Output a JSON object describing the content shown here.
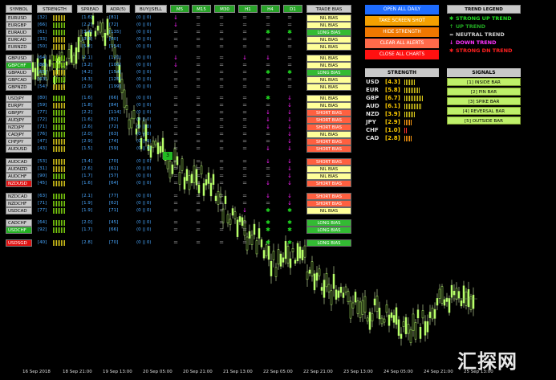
{
  "headers": {
    "symbol": "SYMBOL",
    "strength": "STRENGTH",
    "spread": "SPREAD",
    "adr": "ADR(5)",
    "buysell": "BUY||SELL",
    "m5": "M5",
    "m15": "M15",
    "m30": "M30",
    "h1": "H1",
    "h4": "H4",
    "d1": "D1",
    "trade_bias": "TRADE BIAS"
  },
  "rows": [
    {
      "symbol": "EURUSD",
      "sym_color": "grey",
      "strength": "[32]",
      "spread": "[1.6]",
      "adr": "[81]",
      "bs": "(0 || 0)",
      "tf": [
        "dn",
        "nt",
        "nt",
        "nt",
        "nt",
        "nt"
      ],
      "bias": "NIL BIAS",
      "bias_type": "nil"
    },
    {
      "symbol": "EURGBP",
      "sym_color": "grey",
      "strength": "[66]",
      "spread": "[2.2]",
      "adr": "[72]",
      "bs": "(0 || 0)",
      "tf": [
        "dn",
        "nt",
        "nt",
        "nt",
        "nt",
        "nt"
      ],
      "bias": "NIL BIAS",
      "bias_type": "nil"
    },
    {
      "symbol": "EURAUD",
      "sym_color": "grey",
      "strength": "[61]",
      "spread": "[3.4]",
      "adr": "[135]",
      "bs": "(0 || 0)",
      "tf": [
        "nt",
        "nt",
        "nt",
        "nt",
        "up",
        "up"
      ],
      "bias": "LONG BIAS",
      "bias_type": "long"
    },
    {
      "symbol": "EURCAD",
      "sym_color": "grey",
      "strength": "[33]",
      "spread": "[3.3]",
      "adr": "[80]",
      "bs": "(0 || 0)",
      "tf": [
        "nt",
        "nt",
        "nt",
        "nt",
        "nt",
        "nt"
      ],
      "bias": "NIL BIAS",
      "bias_type": "nil"
    },
    {
      "symbol": "EURNZD",
      "sym_color": "grey",
      "strength": "[50]",
      "spread": "[5.2]",
      "adr": "[154]",
      "bs": "(0 || 0)",
      "tf": [
        "nt",
        "nt",
        "nt",
        "nt",
        "nt",
        "nt"
      ],
      "bias": "NIL BIAS",
      "bias_type": "nil"
    },
    {
      "symbol": "GBPUSD",
      "sym_color": "grey",
      "strength": "[64]",
      "spread": "[2.1]",
      "adr": "[120]",
      "bs": "(0 || 0)",
      "tf": [
        "dn",
        "nt",
        "nt",
        "dn",
        "dn",
        "nt"
      ],
      "bias": "NIL BIAS",
      "bias_type": "nil"
    },
    {
      "symbol": "GBPCHF",
      "sym_color": "green",
      "strength": "[86]",
      "spread": "[3.2]",
      "adr": "[106]",
      "bs": "(0 || 0)",
      "tf": [
        "dn",
        "nt",
        "nt",
        "nt",
        "nt",
        "nt"
      ],
      "bias": "NIL BIAS",
      "bias_type": "nil"
    },
    {
      "symbol": "GBPAUD",
      "sym_color": "grey",
      "strength": "[55]",
      "spread": "[4.2]",
      "adr": "[154]",
      "bs": "(0 || 0)",
      "tf": [
        "nt",
        "nt",
        "nt",
        "nt",
        "up",
        "up"
      ],
      "bias": "LONG BIAS",
      "bias_type": "long"
    },
    {
      "symbol": "GBPCAD",
      "sym_color": "grey",
      "strength": "[63]",
      "spread": "[4.3]",
      "adr": "[125]",
      "bs": "(0 || 0)",
      "tf": [
        "nt",
        "nt",
        "nt",
        "nt",
        "nt",
        "nt"
      ],
      "bias": "NIL BIAS",
      "bias_type": "nil"
    },
    {
      "symbol": "GBPNZD",
      "sym_color": "grey",
      "strength": "[54]",
      "spread": "[2.9]",
      "adr": "[199]",
      "bs": "(0 || 0)",
      "tf": [
        "nt",
        "nt",
        "nt",
        "nt",
        "nt",
        "nt"
      ],
      "bias": "NIL BIAS",
      "bias_type": "nil"
    },
    {
      "symbol": "USDJPY",
      "sym_color": "grey",
      "strength": "[80]",
      "spread": "[1.6]",
      "adr": "[66]",
      "bs": "(0 || 0)",
      "tf": [
        "nt",
        "nt",
        "nt",
        "nt",
        "up",
        "dn"
      ],
      "bias": "NIL BIAS",
      "bias_type": "nil"
    },
    {
      "symbol": "EURJPY",
      "sym_color": "grey",
      "strength": "[59]",
      "spread": "[1.8]",
      "adr": "[84]",
      "bs": "(0 || 0)",
      "tf": [
        "nt",
        "nt",
        "nt",
        "nt",
        "nt",
        "dn"
      ],
      "bias": "NIL BIAS",
      "bias_type": "nil"
    },
    {
      "symbol": "GBPJPY",
      "sym_color": "grey",
      "strength": "[77]",
      "spread": "[2.2]",
      "adr": "[114]",
      "bs": "(0 || 0)",
      "tf": [
        "nt",
        "nt",
        "nt",
        "nt",
        "dn",
        "dn"
      ],
      "bias": "SHORT BIAS",
      "bias_type": "short"
    },
    {
      "symbol": "AUDJPY",
      "sym_color": "grey",
      "strength": "[72]",
      "spread": "[1.6]",
      "adr": "[82]",
      "bs": "(0 || 0)",
      "tf": [
        "nt",
        "nt",
        "nt",
        "nt",
        "dn",
        "dn"
      ],
      "bias": "SHORT BIAS",
      "bias_type": "short"
    },
    {
      "symbol": "NZDJPY",
      "sym_color": "grey",
      "strength": "[71]",
      "spread": "[2.6]",
      "adr": "[72]",
      "bs": "(0 || 0)",
      "tf": [
        "nt",
        "nt",
        "nt",
        "nt",
        "dn",
        "dn"
      ],
      "bias": "SHORT BIAS",
      "bias_type": "short"
    },
    {
      "symbol": "CADJPY",
      "sym_color": "grey",
      "strength": "[76]",
      "spread": "[2.0]",
      "adr": "[63]",
      "bs": "(0 || 0)",
      "tf": [
        "nt",
        "nt",
        "nt",
        "nt",
        "nt",
        "dn"
      ],
      "bias": "NIL BIAS",
      "bias_type": "nil"
    },
    {
      "symbol": "CHFJPY",
      "sym_color": "grey",
      "strength": "[47]",
      "spread": "[2.9]",
      "adr": "[74]",
      "bs": "(0 || 0)",
      "tf": [
        "nt",
        "nt",
        "nt",
        "nt",
        "nt",
        "dn"
      ],
      "bias": "SHORT BIAS",
      "bias_type": "short"
    },
    {
      "symbol": "AUDUSD",
      "sym_color": "grey",
      "strength": "[43]",
      "spread": "[1.5]",
      "adr": "[59]",
      "bs": "(0 || 0)",
      "tf": [
        "nt",
        "nt",
        "nt",
        "nt",
        "dn",
        "dn"
      ],
      "bias": "SHORT BIAS",
      "bias_type": "short"
    },
    {
      "symbol": "AUDCAD",
      "sym_color": "grey",
      "strength": "[53]",
      "spread": "[3.4]",
      "adr": "[70]",
      "bs": "(0 || 0)",
      "tf": [
        "nt",
        "nt",
        "nt",
        "nt",
        "dn",
        "dn"
      ],
      "bias": "SHORT BIAS",
      "bias_type": "short"
    },
    {
      "symbol": "AUDNZD",
      "sym_color": "grey",
      "strength": "[31]",
      "spread": "[2.6]",
      "adr": "[61]",
      "bs": "(0 || 0)",
      "tf": [
        "nt",
        "nt",
        "nt",
        "nt",
        "nt",
        "dn"
      ],
      "bias": "NIL BIAS",
      "bias_type": "nil"
    },
    {
      "symbol": "AUDCHF",
      "sym_color": "grey",
      "strength": "[90]",
      "spread": "[1.7]",
      "adr": "[57]",
      "bs": "(0 || 0)",
      "tf": [
        "nt",
        "nt",
        "nt",
        "nt",
        "nt",
        "dn"
      ],
      "bias": "NIL BIAS",
      "bias_type": "nil"
    },
    {
      "symbol": "NZDUSD",
      "sym_color": "red",
      "strength": "[45]",
      "spread": "[1.6]",
      "adr": "[64]",
      "bs": "(0 || 0)",
      "tf": [
        "nt",
        "nt",
        "nt",
        "nt",
        "dn",
        "dn"
      ],
      "bias": "SHORT BIAS",
      "bias_type": "short"
    },
    {
      "symbol": "NZDCAD",
      "sym_color": "grey",
      "strength": "[63]",
      "spread": "[2.1]",
      "adr": "[77]",
      "bs": "(0 || 0)",
      "tf": [
        "nt",
        "nt",
        "nt",
        "nt",
        "dn",
        "dn"
      ],
      "bias": "SHORT BIAS",
      "bias_type": "short"
    },
    {
      "symbol": "NZDCHF",
      "sym_color": "grey",
      "strength": "[71]",
      "spread": "[1.9]",
      "adr": "[62]",
      "bs": "(0 || 0)",
      "tf": [
        "nt",
        "nt",
        "nt",
        "nt",
        "nt",
        "dn"
      ],
      "bias": "SHORT BIAS",
      "bias_type": "short"
    },
    {
      "symbol": "USDCAD",
      "sym_color": "grey",
      "strength": "[77]",
      "spread": "[1.9]",
      "adr": "[71]",
      "bs": "(0 || 0)",
      "tf": [
        "nt",
        "nt",
        "nt",
        "dn",
        "up",
        "up"
      ],
      "bias": "NIL BIAS",
      "bias_type": "nil"
    },
    {
      "symbol": "CADCHF",
      "sym_color": "grey",
      "strength": "[64]",
      "spread": "[2.0]",
      "adr": "[45]",
      "bs": "(0 || 0)",
      "tf": [
        "nt",
        "nt",
        "nt",
        "nt",
        "up",
        "up"
      ],
      "bias": "LONG BIAS",
      "bias_type": "long"
    },
    {
      "symbol": "USDCHF",
      "sym_color": "green",
      "strength": "[92]",
      "spread": "[1.7]",
      "adr": "[66]",
      "bs": "(0 || 0)",
      "tf": [
        "nt",
        "nt",
        "nt",
        "nt",
        "up",
        "up"
      ],
      "bias": "LONG BIAS",
      "bias_type": "long"
    },
    {
      "symbol": "USDSGD",
      "sym_color": "red",
      "strength": "[40]",
      "spread": "[2.8]",
      "adr": "[70]",
      "bs": "(0 || 0)",
      "tf": [
        "nt",
        "nt",
        "nt",
        "nt",
        "up",
        "up"
      ],
      "bias": "LONG BIAS",
      "bias_type": "long"
    }
  ],
  "buttons": [
    {
      "label": "OPEN ALL DAILY",
      "color": "#1e6cff"
    },
    {
      "label": "TAKE SCREEN SHOT",
      "color": "#f4a000"
    },
    {
      "label": "HIDE STRENGTH",
      "color": "#f07800"
    },
    {
      "label": "CLEAR ALL ALERTS",
      "color": "#ff6a4a"
    },
    {
      "label": "CLOSE ALL CHARTS",
      "color": "#ff1010"
    }
  ],
  "legend": {
    "title": "TREND LEGEND",
    "items": [
      {
        "symbol": "✱",
        "label": "STRONG UP TREND",
        "color": "#22dd22"
      },
      {
        "symbol": "↑",
        "label": "UP TREND",
        "color": "#22aa22"
      },
      {
        "symbol": "=",
        "label": "NEUTRAL TREND",
        "color": "#cfcfcf"
      },
      {
        "symbol": "↓",
        "label": "DOWN TREND",
        "color": "#ff33ff"
      },
      {
        "symbol": "✱",
        "label": "STRONG DN TREND",
        "color": "#ff2020"
      }
    ]
  },
  "strength": {
    "title": "STRENGTH",
    "items": [
      {
        "cur": "USD",
        "val": "[4.3]",
        "bars": 7
      },
      {
        "cur": "EUR",
        "val": "[5.8]",
        "bars": 10
      },
      {
        "cur": "GBP",
        "val": "[6.7]",
        "bars": 12
      },
      {
        "cur": "AUD",
        "val": "[6.1]",
        "bars": 11
      },
      {
        "cur": "NZD",
        "val": "[3.9]",
        "bars": 7
      },
      {
        "cur": "JPY",
        "val": "[2.9]",
        "bars": 5
      },
      {
        "cur": "CHF",
        "val": "[1.0]",
        "bars": 2
      },
      {
        "cur": "CAD",
        "val": "[2.8]",
        "bars": 5
      }
    ]
  },
  "signals": {
    "title": "SIGNALS",
    "items": [
      "[1] INSIDE BAR",
      "[2] PIN BAR",
      "[3] SPIKE BAR",
      "[4] REVERSAL BAR",
      "[5] OUTSIDE BAR"
    ]
  },
  "marker_label": "3",
  "x_axis": [
    "16 Sep 2018",
    "18 Sep 21:00",
    "19 Sep 13:00",
    "20 Sep 05:00",
    "20 Sep 21:00",
    "21 Sep 13:00",
    "22 Sep 05:00",
    "22 Sep 21:00",
    "23 Sep 13:00",
    "24 Sep 05:00",
    "24 Sep 21:00",
    "25 Sep 13:00"
  ],
  "watermark": "汇探网"
}
